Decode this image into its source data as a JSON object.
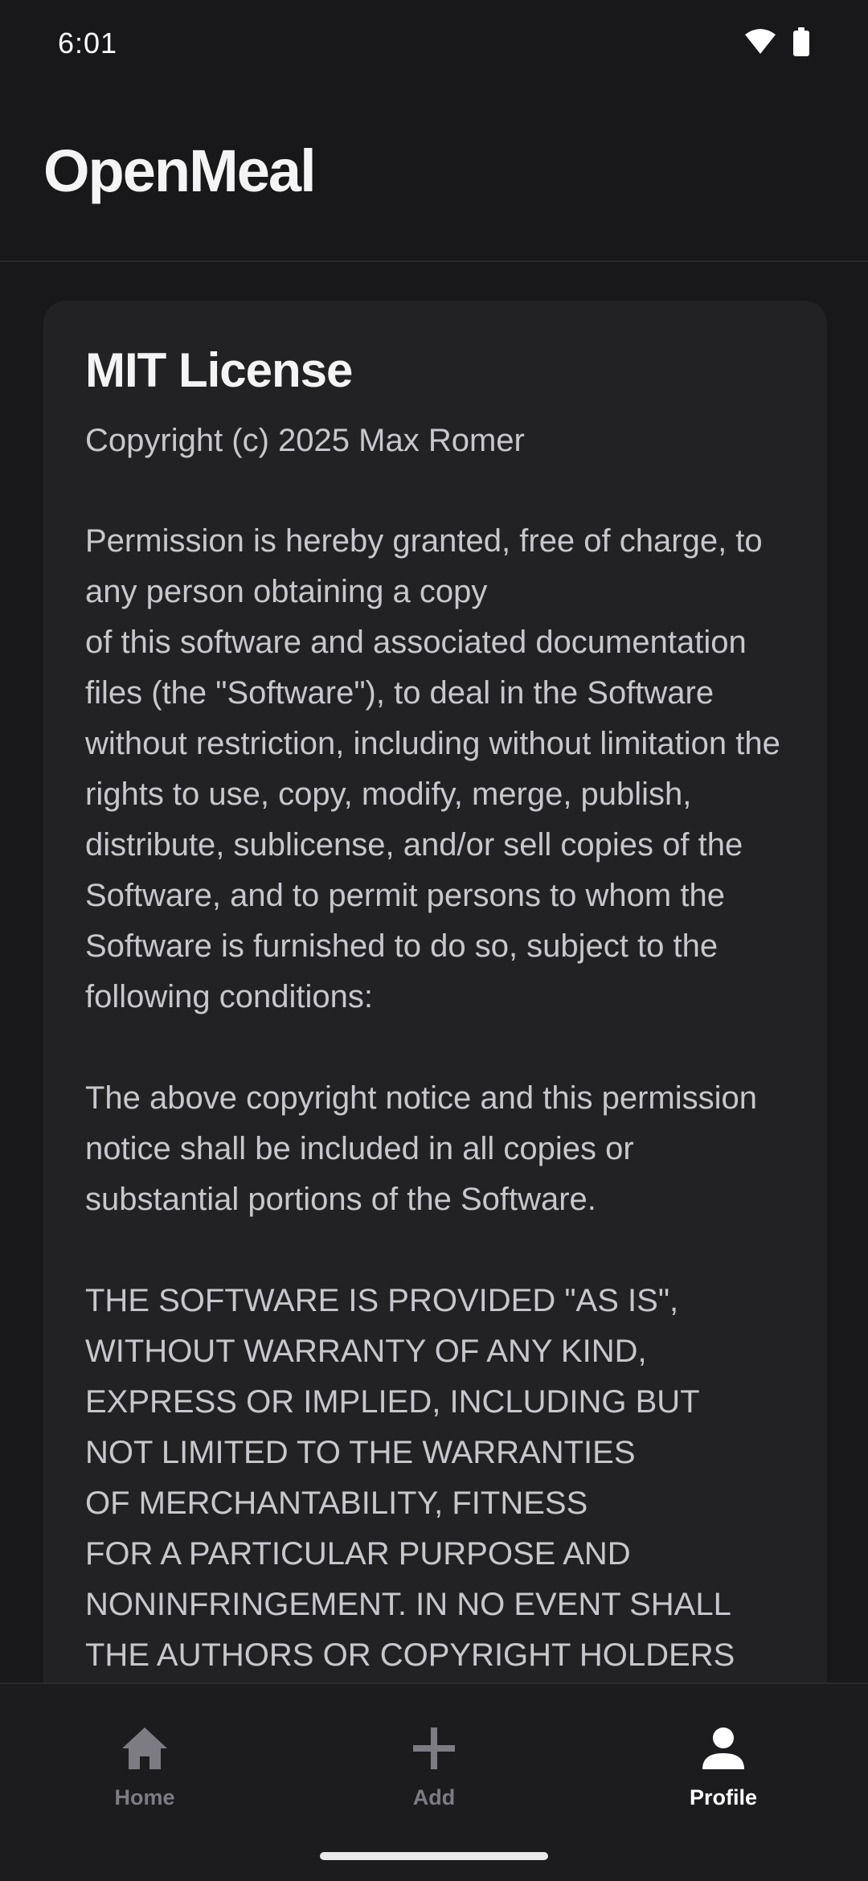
{
  "status_bar": {
    "time": "6:01",
    "icons": [
      "wifi-icon",
      "battery-icon"
    ]
  },
  "app": {
    "title": "OpenMeal"
  },
  "license": {
    "title": "MIT License",
    "copyright": "Copyright (c) 2025 Max Romer",
    "paragraphs": [
      "Permission is hereby granted, free of charge, to any person obtaining a copy\nof this software and associated documentation files (the \"Software\"), to deal in the Software without restriction, including without limitation the rights to use, copy, modify, merge, publish, distribute, sublicense, and/or sell copies of the Software, and to permit persons to whom the Software is furnished to do so, subject to the following conditions:",
      "The above copyright notice and this permission notice shall be included in all copies or substantial portions of the Software.",
      "THE SOFTWARE IS PROVIDED \"AS IS\",\nWITHOUT WARRANTY OF ANY KIND,\nEXPRESS OR IMPLIED, INCLUDING BUT\nNOT LIMITED TO THE WARRANTIES\nOF MERCHANTABILITY, FITNESS\nFOR A PARTICULAR PURPOSE AND\nNONINFRINGEMENT. IN NO EVENT SHALL\nTHE AUTHORS OR COPYRIGHT HOLDERS"
    ]
  },
  "bottom_nav": {
    "items": [
      {
        "label": "Home",
        "icon": "home-icon",
        "active": false
      },
      {
        "label": "Add",
        "icon": "plus-icon",
        "active": false
      },
      {
        "label": "Profile",
        "icon": "person-icon",
        "active": true
      }
    ]
  },
  "colors": {
    "background": "#18181b",
    "card": "#222225",
    "active_nav": "#ffffff",
    "inactive_nav": "#7c7c82"
  }
}
